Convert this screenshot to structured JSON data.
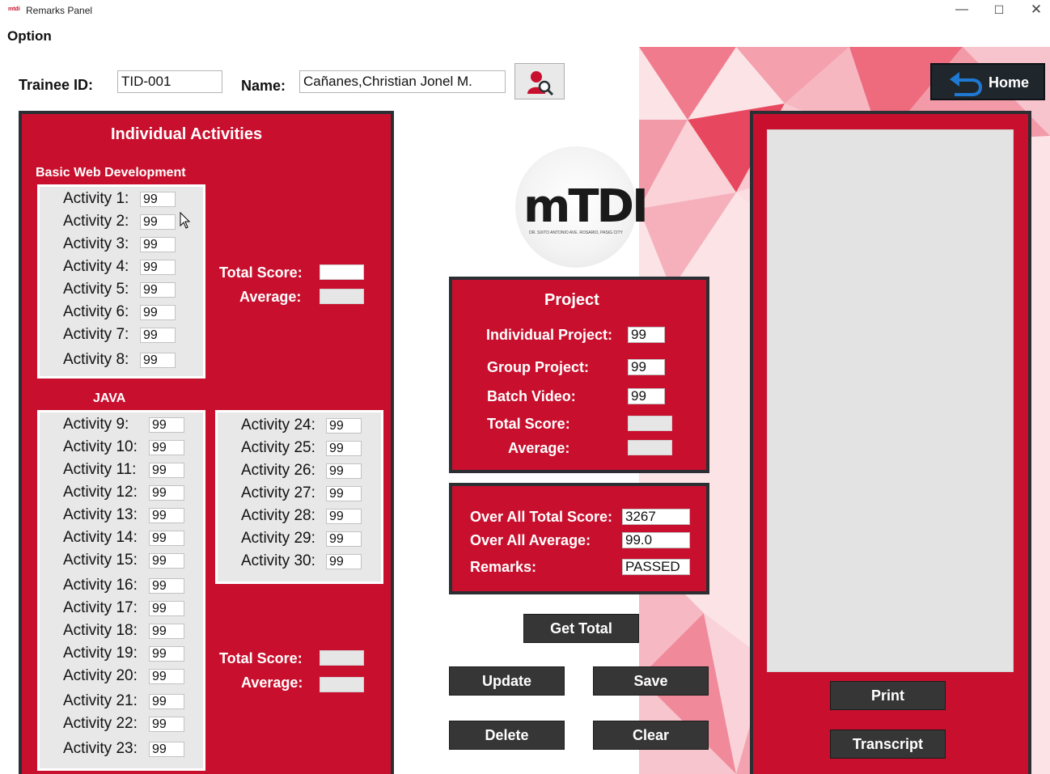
{
  "window": {
    "title": "Remarks Panel",
    "icon_text": "mtdi",
    "minimize": "—",
    "maximize": "☐",
    "close": "✕"
  },
  "menu": {
    "option": "Option"
  },
  "header": {
    "trainee_id_label": "Trainee ID:",
    "trainee_id_value": "TID-001",
    "name_label": "Name:",
    "name_value": "Cañanes,Christian Jonel M.",
    "search_button_icon": "user-search-icon",
    "home_label": "Home"
  },
  "individual": {
    "title": "Individual Activities",
    "basic_web": {
      "title": "Basic Web Development",
      "activities": [
        {
          "label": "Activity 1:",
          "value": "99"
        },
        {
          "label": "Activity 2:",
          "value": "99"
        },
        {
          "label": "Activity 3:",
          "value": "99"
        },
        {
          "label": "Activity 4:",
          "value": "99"
        },
        {
          "label": "Activity 5:",
          "value": "99"
        },
        {
          "label": "Activity 6:",
          "value": "99"
        },
        {
          "label": "Activity 7:",
          "value": "99"
        },
        {
          "label": "Activity 8:",
          "value": "99"
        }
      ],
      "total_label": "Total Score:",
      "average_label": "Average:"
    },
    "java": {
      "title": "JAVA",
      "activities_left": [
        {
          "label": "Activity 9:",
          "value": "99"
        },
        {
          "label": "Activity 10:",
          "value": "99"
        },
        {
          "label": "Activity 11:",
          "value": "99"
        },
        {
          "label": "Activity 12:",
          "value": "99"
        },
        {
          "label": "Activity 13:",
          "value": "99"
        },
        {
          "label": "Activity 14:",
          "value": "99"
        },
        {
          "label": "Activity 15:",
          "value": "99"
        },
        {
          "label": "Activity 16:",
          "value": "99"
        },
        {
          "label": "Activity 17:",
          "value": "99"
        },
        {
          "label": "Activity 18:",
          "value": "99"
        },
        {
          "label": "Activity 19:",
          "value": "99"
        },
        {
          "label": "Activity 20:",
          "value": "99"
        },
        {
          "label": "Activity 21:",
          "value": "99"
        },
        {
          "label": "Activity 22:",
          "value": "99"
        },
        {
          "label": "Activity 23:",
          "value": "99"
        }
      ],
      "activities_right": [
        {
          "label": "Activity 24:",
          "value": "99"
        },
        {
          "label": "Activity 25:",
          "value": "99"
        },
        {
          "label": "Activity 26:",
          "value": "99"
        },
        {
          "label": "Activity 27:",
          "value": "99"
        },
        {
          "label": "Activity 28:",
          "value": "99"
        },
        {
          "label": "Activity 29:",
          "value": "99"
        },
        {
          "label": "Activity 30:",
          "value": "99"
        }
      ],
      "total_label": "Total Score:",
      "average_label": "Average:"
    }
  },
  "logo": {
    "text": "mTDI",
    "subtitle": "DR. SIXTO ANTONIO AVE. ROSARIO, PASIG CITY"
  },
  "project": {
    "title": "Project",
    "individual_label": "Individual Project:",
    "individual_value": "99",
    "group_label": "Group Project:",
    "group_value": "99",
    "batch_label": "Batch Video:",
    "batch_value": "99",
    "total_label": "Total Score:",
    "average_label": "Average:"
  },
  "overall": {
    "total_label": "Over All Total Score:",
    "total_value": "3267",
    "average_label": "Over All Average:",
    "average_value": "99.0",
    "remarks_label": "Remarks:",
    "remarks_value": "PASSED"
  },
  "buttons": {
    "get_total": "Get Total",
    "update": "Update",
    "save": "Save",
    "delete": "Delete",
    "clear": "Clear",
    "print": "Print",
    "transcript": "Transcript"
  },
  "colors": {
    "panel_red": "#c8102e",
    "panel_border": "#2b2f33",
    "button_dark": "#363636"
  }
}
